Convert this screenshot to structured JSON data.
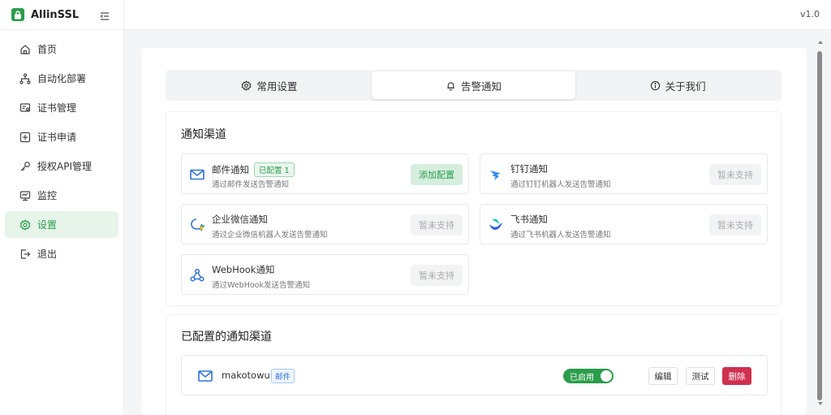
{
  "app": {
    "name": "AllinSSL",
    "version": "v1.0"
  },
  "sidebar": {
    "items": [
      {
        "label": "首页",
        "icon": "home-icon"
      },
      {
        "label": "自动化部署",
        "icon": "workflow-icon"
      },
      {
        "label": "证书管理",
        "icon": "certificate-icon"
      },
      {
        "label": "证书申请",
        "icon": "plus-square-icon"
      },
      {
        "label": "授权API管理",
        "icon": "key-icon"
      },
      {
        "label": "监控",
        "icon": "monitor-icon"
      },
      {
        "label": "设置",
        "icon": "gear-icon",
        "active": true
      },
      {
        "label": "退出",
        "icon": "logout-icon"
      }
    ]
  },
  "tabs": [
    {
      "label": "常用设置",
      "icon": "gear-icon"
    },
    {
      "label": "告警通知",
      "icon": "bell-icon",
      "active": true
    },
    {
      "label": "关于我们",
      "icon": "info-icon"
    }
  ],
  "channels": {
    "title": "通知渠道",
    "items": [
      {
        "name": "邮件通知",
        "badge": "已配置 1",
        "desc": "通过邮件发送告警通知",
        "button": "添加配置",
        "icon": "mail-icon"
      },
      {
        "name": "钉钉通知",
        "desc": "通过钉钉机器人发送告警通知",
        "button": "暂未支持",
        "icon": "dingtalk-icon"
      },
      {
        "name": "企业微信通知",
        "desc": "通过企业微信机器人发送告警通知",
        "button": "暂未支持",
        "icon": "wecom-icon"
      },
      {
        "name": "飞书通知",
        "desc": "通过飞书机器人发送告警通知",
        "button": "暂未支持",
        "icon": "feishu-icon"
      },
      {
        "name": "WebHook通知",
        "desc": "通过WebHook发送告警通知",
        "button": "暂未支持",
        "icon": "webhook-icon"
      }
    ]
  },
  "configured": {
    "title": "已配置的通知渠道",
    "row": {
      "name": "makotowu",
      "tag": "邮件",
      "status": "已启用",
      "edit": "编辑",
      "test": "测试",
      "delete": "删除"
    }
  },
  "colors": {
    "accent": "#2a9d4b",
    "danger": "#d03050",
    "tag_blue": "#2f73d9"
  }
}
